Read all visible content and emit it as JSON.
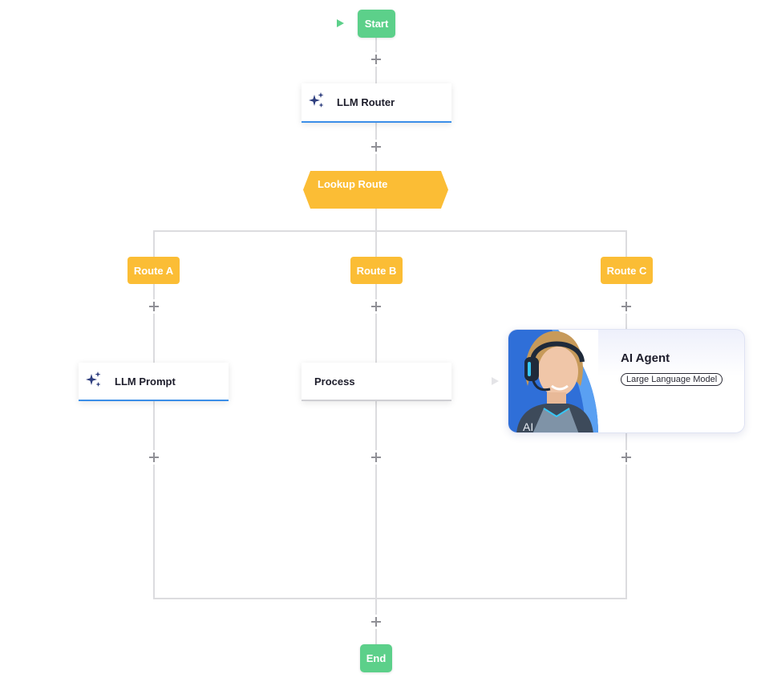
{
  "flow": {
    "start_label": "Start",
    "end_label": "End",
    "llm_router": {
      "title": "LLM Router",
      "icon": "sparkle-icon"
    },
    "lookup_route": {
      "label": "Lookup Route"
    },
    "routes": [
      {
        "label": "Route A"
      },
      {
        "label": "Route B"
      },
      {
        "label": "Route C"
      }
    ],
    "llm_prompt": {
      "title": "LLM Prompt",
      "icon": "sparkle-icon"
    },
    "process": {
      "title": "Process"
    },
    "ai_agent": {
      "title": "AI Agent",
      "badge": "Large Language Model",
      "photo_text": "AI"
    }
  },
  "colors": {
    "green": "#5cd08a",
    "orange": "#fbbd35",
    "blue_accent": "#3b8ee8",
    "connector": "#dcdcdf",
    "sparkle": "#2f3f7f"
  }
}
